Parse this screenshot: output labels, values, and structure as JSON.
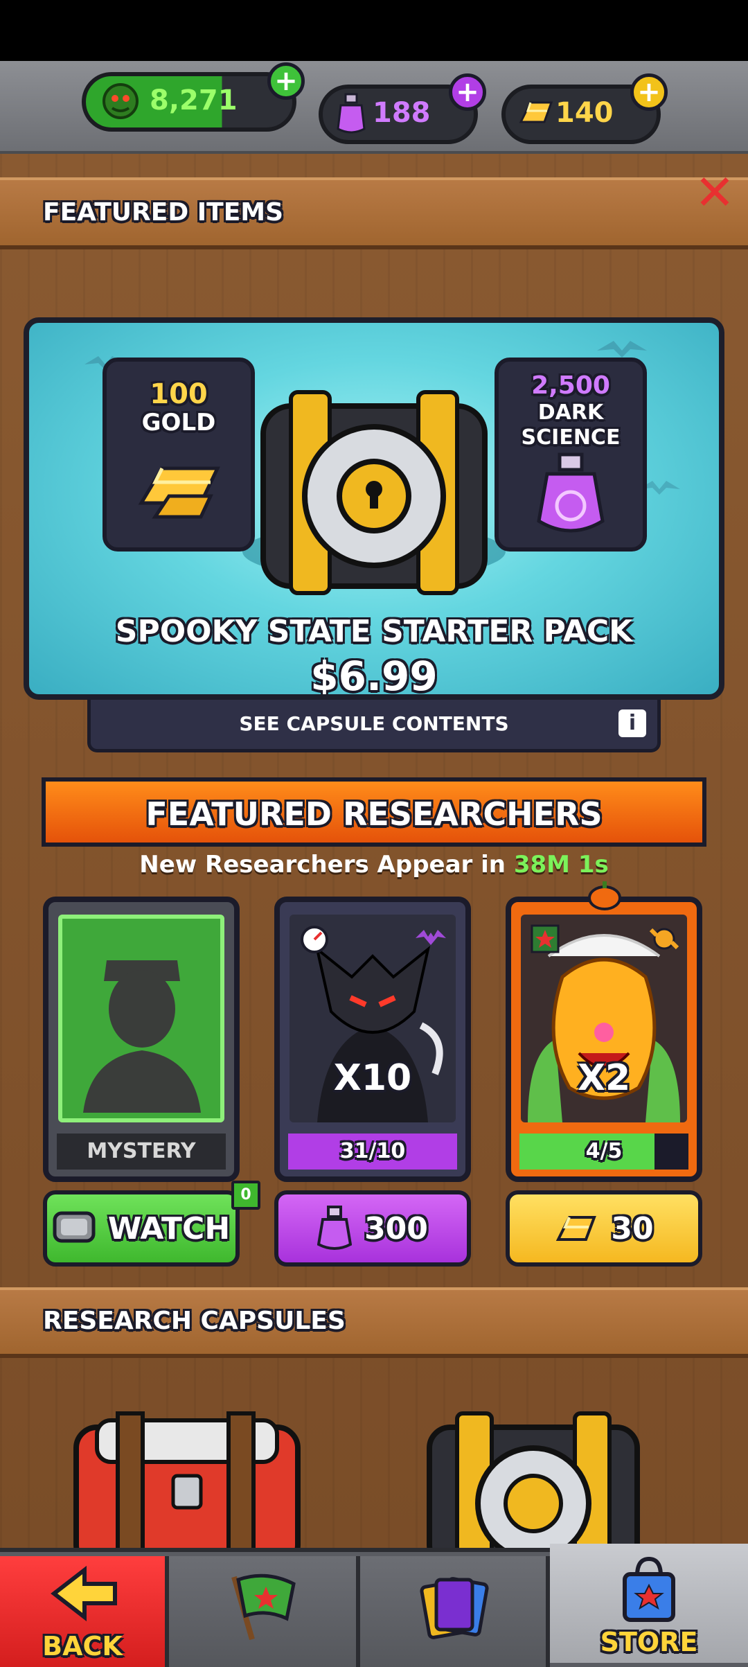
{
  "currencies": {
    "cash": {
      "value": "8,271",
      "icon": "green-cash-icon"
    },
    "dark_science": {
      "value": "188",
      "icon": "purple-potion-icon"
    },
    "gold": {
      "value": "140",
      "icon": "gold-bar-icon"
    }
  },
  "featured_items": {
    "title": "FEATURED ITEMS",
    "pack": {
      "left_reward": {
        "amount": "100",
        "label": "GOLD"
      },
      "right_reward": {
        "amount": "2,500",
        "label_line1": "DARK",
        "label_line2": "SCIENCE"
      },
      "name": "SPOOKY STATE STARTER PACK",
      "price": "$6.99",
      "contents_label": "SEE CAPSULE CONTENTS"
    }
  },
  "featured_researchers": {
    "title": "FEATURED RESEARCHERS",
    "timer_prefix": "New Researchers Appear in",
    "timer_value": "38M 1s",
    "cards": [
      {
        "label": "MYSTERY",
        "button": "WATCH",
        "badge": "0"
      },
      {
        "multiplier": "X10",
        "progress_text": "31/10",
        "progress": 1.0,
        "cost": "300"
      },
      {
        "multiplier": "X2",
        "progress_text": "4/5",
        "progress": 0.8,
        "cost": "30"
      }
    ]
  },
  "research_capsules": {
    "title": "RESEARCH CAPSULES"
  },
  "nav": {
    "back": "BACK",
    "store": "STORE"
  },
  "colors": {
    "green": "#3fc23a",
    "purple": "#b13ee6",
    "gold": "#ffc83a",
    "orange": "#f06a10",
    "red": "#e82a2a"
  }
}
